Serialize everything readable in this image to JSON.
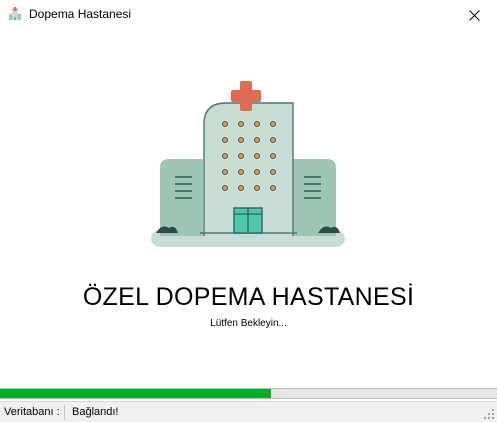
{
  "window": {
    "title": "Dopema Hastanesi",
    "icon": "hospital-icon"
  },
  "titlebar": {
    "close_icon": "close-icon"
  },
  "splash": {
    "illustration": "hospital-building-illustration",
    "heading": "ÖZEL DOPEMA HASTANESİ",
    "subtext": "Lütfen Bekleyin...",
    "progress_fraction": 0.545
  },
  "statusbar": {
    "label": "Veritabanı :",
    "value": "Bağlandı!"
  },
  "colors": {
    "progress": "#06b025",
    "cross": "#e06a52",
    "building_light": "#c7ddd3",
    "building_dark": "#9ec6b4",
    "window_dot": "#c4a24a",
    "door": "#4fc8ac"
  }
}
